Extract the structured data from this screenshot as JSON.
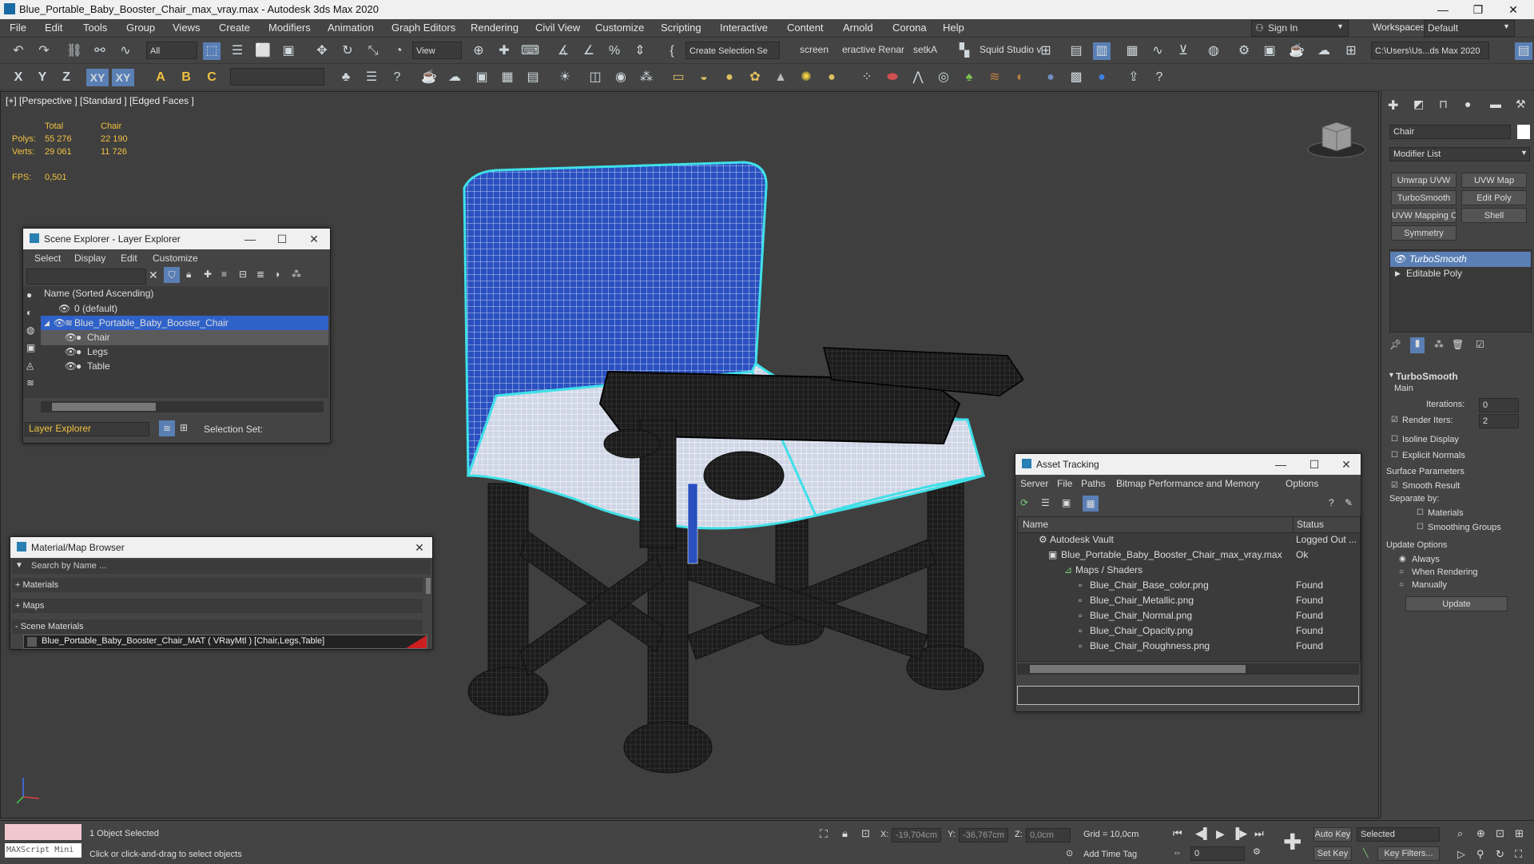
{
  "app": {
    "title": "Blue_Portable_Baby_Booster_Chair_max_vray.max - Autodesk 3ds Max 2020",
    "minimize_glyph": "—",
    "restore_glyph": "❐",
    "close_glyph": "✕"
  },
  "menu": [
    "File",
    "Edit",
    "Tools",
    "Group",
    "Views",
    "Create",
    "Modifiers",
    "Animation",
    "Graph Editors",
    "Rendering",
    "Civil View",
    "Customize",
    "Scripting",
    "Interactive",
    "Content",
    "Arnold",
    "Corona",
    "Help"
  ],
  "account": {
    "sign_in": "Sign In",
    "workspaces_label": "Workspaces:",
    "workspaces_value": "Default"
  },
  "toolbar": {
    "selection_filter": "All",
    "ref_coord": "View",
    "named_selection": "Create Selection Se",
    "shortcut_screen": "screen",
    "shortcut_interactive": "eractive Renar",
    "shortcut_setka": "setkA",
    "squid": "Squid Studio v",
    "project_path": "C:\\Users\\Us...ds Max 2020",
    "axis_x": "X",
    "axis_y": "Y",
    "axis_z": "Z",
    "axis_xy": "XY",
    "axis_xy2": "XY"
  },
  "viewport": {
    "label": "[+] [Perspective ] [Standard ] [Edged Faces ]",
    "stats_total": "Total",
    "stats_object": "Chair",
    "polys_label": "Polys:",
    "polys_total": "55 276",
    "polys_object": "22 190",
    "verts_label": "Verts:",
    "verts_total": "29 061",
    "verts_object": "11 726",
    "fps_label": "FPS:",
    "fps_value": "0,501"
  },
  "scene_explorer": {
    "title": "Scene Explorer - Layer Explorer",
    "menu": [
      "Select",
      "Display",
      "Edit",
      "Customize"
    ],
    "column_header": "Name (Sorted Ascending)",
    "rows": [
      {
        "name": "0 (default)"
      },
      {
        "name": "Blue_Portable_Baby_Booster_Chair"
      },
      {
        "name": "Chair"
      },
      {
        "name": "Legs"
      },
      {
        "name": "Table"
      }
    ],
    "footer_mode": "Layer Explorer",
    "selection_set_label": "Selection Set:"
  },
  "material_browser": {
    "title": "Material/Map Browser",
    "search_placeholder": "Search by Name ...",
    "sections": [
      "+ Materials",
      "+ Maps",
      "- Scene Materials"
    ],
    "scene_material": "Blue_Portable_Baby_Booster_Chair_MAT  ( VRayMtl )  [Chair,Legs,Table]",
    "scene_material_swatch": "#cc2020"
  },
  "asset_tracking": {
    "title": "Asset Tracking",
    "menu": [
      "Server",
      "File",
      "Paths",
      "Bitmap Performance and Memory",
      "Options"
    ],
    "col_name": "Name",
    "col_status": "Status",
    "rows": [
      {
        "name": "Autodesk Vault",
        "status": "Logged Out ..."
      },
      {
        "name": "Blue_Portable_Baby_Booster_Chair_max_vray.max",
        "status": "Ok"
      },
      {
        "name": "Maps / Shaders",
        "status": ""
      },
      {
        "name": "Blue_Chair_Base_color.png",
        "status": "Found"
      },
      {
        "name": "Blue_Chair_Metallic.png",
        "status": "Found"
      },
      {
        "name": "Blue_Chair_Normal.png",
        "status": "Found"
      },
      {
        "name": "Blue_Chair_Opacity.png",
        "status": "Found"
      },
      {
        "name": "Blue_Chair_Roughness.png",
        "status": "Found"
      }
    ]
  },
  "command_panel": {
    "object_name": "Chair",
    "modifier_list": "Modifier List",
    "buttons": [
      "Unwrap UVW",
      "UVW Map",
      "TurboSmooth",
      "Edit Poly",
      "UVW Mapping Clea",
      "Shell",
      "Symmetry"
    ],
    "stack": [
      "TurboSmooth",
      "Editable Poly"
    ],
    "rollout_title": "TurboSmooth",
    "main_label": "Main",
    "iterations_label": "Iterations:",
    "iterations_value": "0",
    "render_iters_label": "Render Iters:",
    "render_iters_value": "2",
    "isoline": "Isoline Display",
    "explicit_normals": "Explicit Normals",
    "surface_params": "Surface Parameters",
    "smooth_result": "Smooth Result",
    "separate_by": "Separate by:",
    "materials": "Materials",
    "smoothing_groups": "Smoothing Groups",
    "update_options": "Update Options",
    "always": "Always",
    "when_rendering": "When Rendering",
    "manually": "Manually",
    "update_button": "Update"
  },
  "status": {
    "maxscript": "MAXScript Mini",
    "selected": "1 Object Selected",
    "prompt": "Click or click-and-drag to select objects",
    "x_label": "X:",
    "x_value": "-19,704cm",
    "y_label": "Y:",
    "y_value": "-36,767cm",
    "z_label": "Z:",
    "z_value": "0,0cm",
    "grid": "Grid = 10,0cm",
    "add_time_tag": "Add Time Tag",
    "auto_key": "Auto Key",
    "set_key": "Set Key",
    "selected_dropdown": "Selected",
    "key_filters": "Key Filters...",
    "frame": "0"
  },
  "colors": {
    "accent_blue": "#2f62c9",
    "selection_cyan": "#3fe0e8",
    "stats_yellow": "#f0c040"
  }
}
